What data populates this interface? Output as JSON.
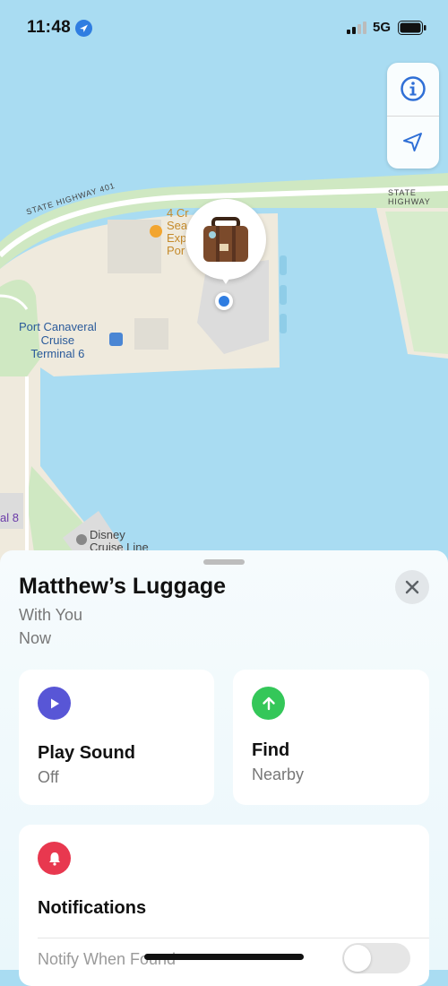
{
  "status_bar": {
    "time": "11:48",
    "network": "5G"
  },
  "map": {
    "labels": {
      "highway_left": "STATE HIGHWAY 401",
      "highway_right": "STATE HIGHWAY",
      "poi_1_line1": "4 Cr",
      "poi_1_line2": "Sea",
      "poi_1_line3": "Exp",
      "poi_1_line4": "Por",
      "terminal_line1": "Port Canaveral",
      "terminal_line2": "Cruise",
      "terminal_line3": "Terminal 6",
      "terminal_partial": "al 8",
      "disney_line1": "Disney",
      "disney_line2": "Cruise Line"
    },
    "accent": "#2f7de1"
  },
  "sheet": {
    "title": "Matthew’s Luggage",
    "subtitle": "With You",
    "updated": "Now",
    "actions": [
      {
        "label": "Play Sound",
        "value": "Off",
        "icon": "play-icon",
        "color": "#5856d6"
      },
      {
        "label": "Find",
        "value": "Nearby",
        "icon": "arrow-up-icon",
        "color": "#34c759"
      }
    ],
    "notifications": {
      "label": "Notifications",
      "icon": "bell-icon",
      "color": "#e8384f",
      "notify_label": "Notify When Found"
    }
  }
}
